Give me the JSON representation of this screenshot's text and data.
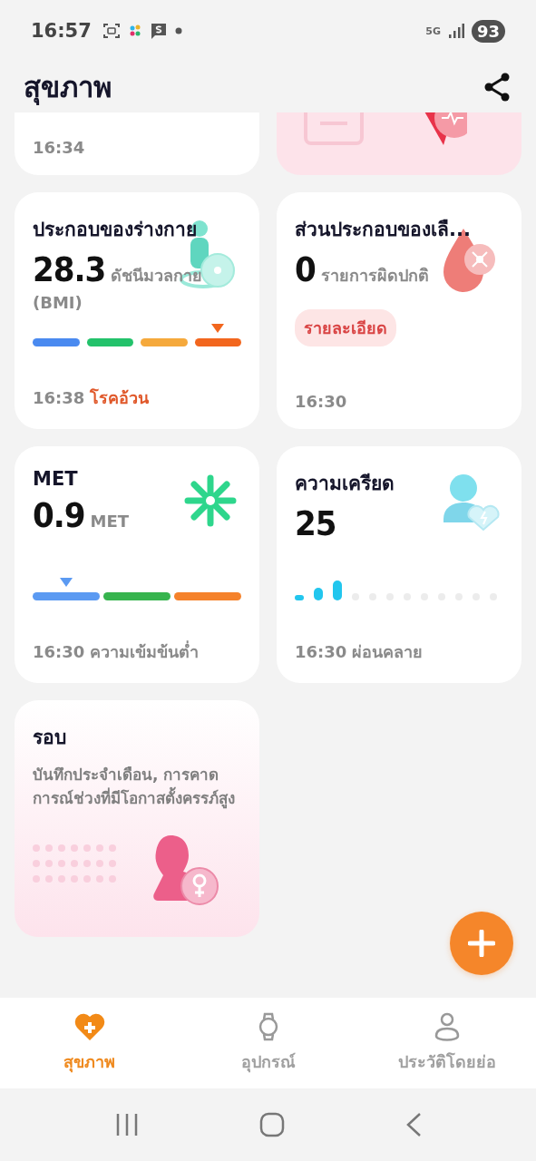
{
  "status_bar": {
    "time": "16:57",
    "network": "5G",
    "battery": "93"
  },
  "header": {
    "title": "สุขภาพ"
  },
  "partial_cards": [
    {
      "kind": "time",
      "time": "16:34"
    },
    {
      "kind": "picture"
    }
  ],
  "cards": [
    {
      "kind": "scale",
      "title": "ประกอบของร่างกาย",
      "value": "28.3",
      "unit": "ดัชนีมวลกาย",
      "unit_2": "(BMI)",
      "segments": [
        {
          "color": "#4a8af0",
          "selected": false
        },
        {
          "color": "#23c26b",
          "selected": false
        },
        {
          "color": "#f5a93c",
          "selected": false
        },
        {
          "color": "#f2661e",
          "selected": true
        }
      ],
      "time": "16:38",
      "status": "โรคอ้วน",
      "alert": true
    },
    {
      "kind": "details",
      "title": "ส่วนประกอบของเลื...",
      "value": "0",
      "unit": "รายการผิดปกติ",
      "button": "รายละเอียด",
      "time": "16:30"
    },
    {
      "kind": "scale",
      "title": "MET",
      "value": "0.9",
      "unit": "MET",
      "segments": [
        {
          "color": "#5b9af2",
          "selected": true
        },
        {
          "color": "#37b44e",
          "selected": false
        },
        {
          "color": "#f5822b",
          "selected": false
        }
      ],
      "time": "16:30",
      "status": "ความเข้มข้นต่ำ",
      "alert": false
    },
    {
      "kind": "meter",
      "title": "ความเครียด",
      "value": "25",
      "level": 0.25,
      "time": "16:30",
      "status": "ผ่อนคลาย",
      "alert": false
    },
    {
      "kind": "cycle",
      "title": "รอบ",
      "description": "บันทึกประจำเดือน, การคาดการณ์ช่วงที่มีโอกาสตั้งครรภ์สูง"
    }
  ],
  "nav": [
    {
      "label": "สุขภาพ",
      "selected": true
    },
    {
      "label": "อุปกรณ์",
      "selected": false
    },
    {
      "label": "ประวัติโดยย่อ",
      "selected": false
    }
  ]
}
